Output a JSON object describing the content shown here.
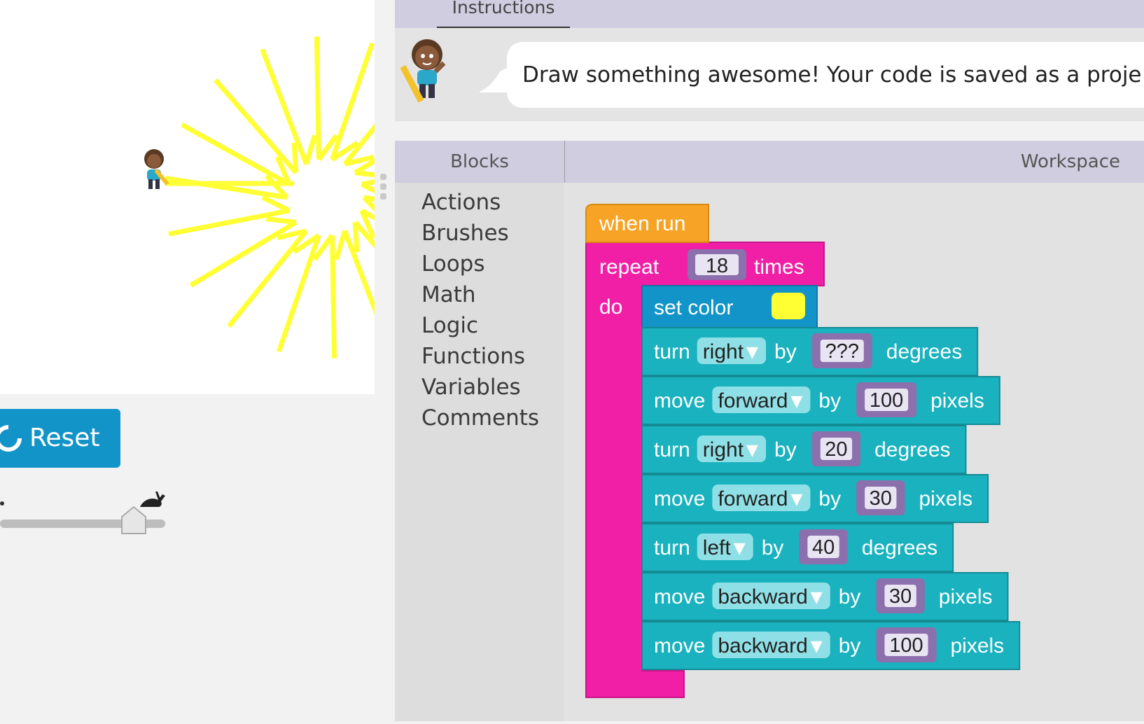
{
  "instructions": {
    "tab_label": "Instructions",
    "message": "Draw something awesome! Your code is saved as a proje"
  },
  "controls": {
    "reset_label": "Reset"
  },
  "toolbox": {
    "header": "Blocks",
    "categories": [
      "Actions",
      "Brushes",
      "Loops",
      "Math",
      "Logic",
      "Functions",
      "Variables",
      "Comments"
    ]
  },
  "workspace": {
    "header": "Workspace",
    "event_block": "when run",
    "repeat": {
      "label": "repeat",
      "count": "18",
      "suffix": "times",
      "do_label": "do"
    },
    "set_color": {
      "label": "set color",
      "color": "#ffff33"
    },
    "statements": [
      {
        "verb": "turn",
        "dir": "right",
        "by": "by",
        "value": "???",
        "unit": "degrees"
      },
      {
        "verb": "move",
        "dir": "forward",
        "by": "by",
        "value": "100",
        "unit": "pixels"
      },
      {
        "verb": "turn",
        "dir": "right",
        "by": "by",
        "value": "20",
        "unit": "degrees"
      },
      {
        "verb": "move",
        "dir": "forward",
        "by": "by",
        "value": "30",
        "unit": "pixels"
      },
      {
        "verb": "turn",
        "dir": "left",
        "by": "by",
        "value": "40",
        "unit": "degrees"
      },
      {
        "verb": "move",
        "dir": "backward",
        "by": "by",
        "value": "30",
        "unit": "pixels"
      },
      {
        "verb": "move",
        "dir": "backward",
        "by": "by",
        "value": "100",
        "unit": "pixels"
      }
    ]
  },
  "colors": {
    "event": "#f7a325",
    "loop": "#f11fa5",
    "color_block": "#1394c9",
    "action": "#1ab2be",
    "number": "#8c6fad",
    "reset": "#1394c9",
    "line": "#ffff33"
  },
  "icons": [
    "artist-character",
    "reset-icon",
    "rabbit-icon",
    "speed-slider-knob",
    "avatar-character",
    "dropdown-arrow-icon"
  ]
}
